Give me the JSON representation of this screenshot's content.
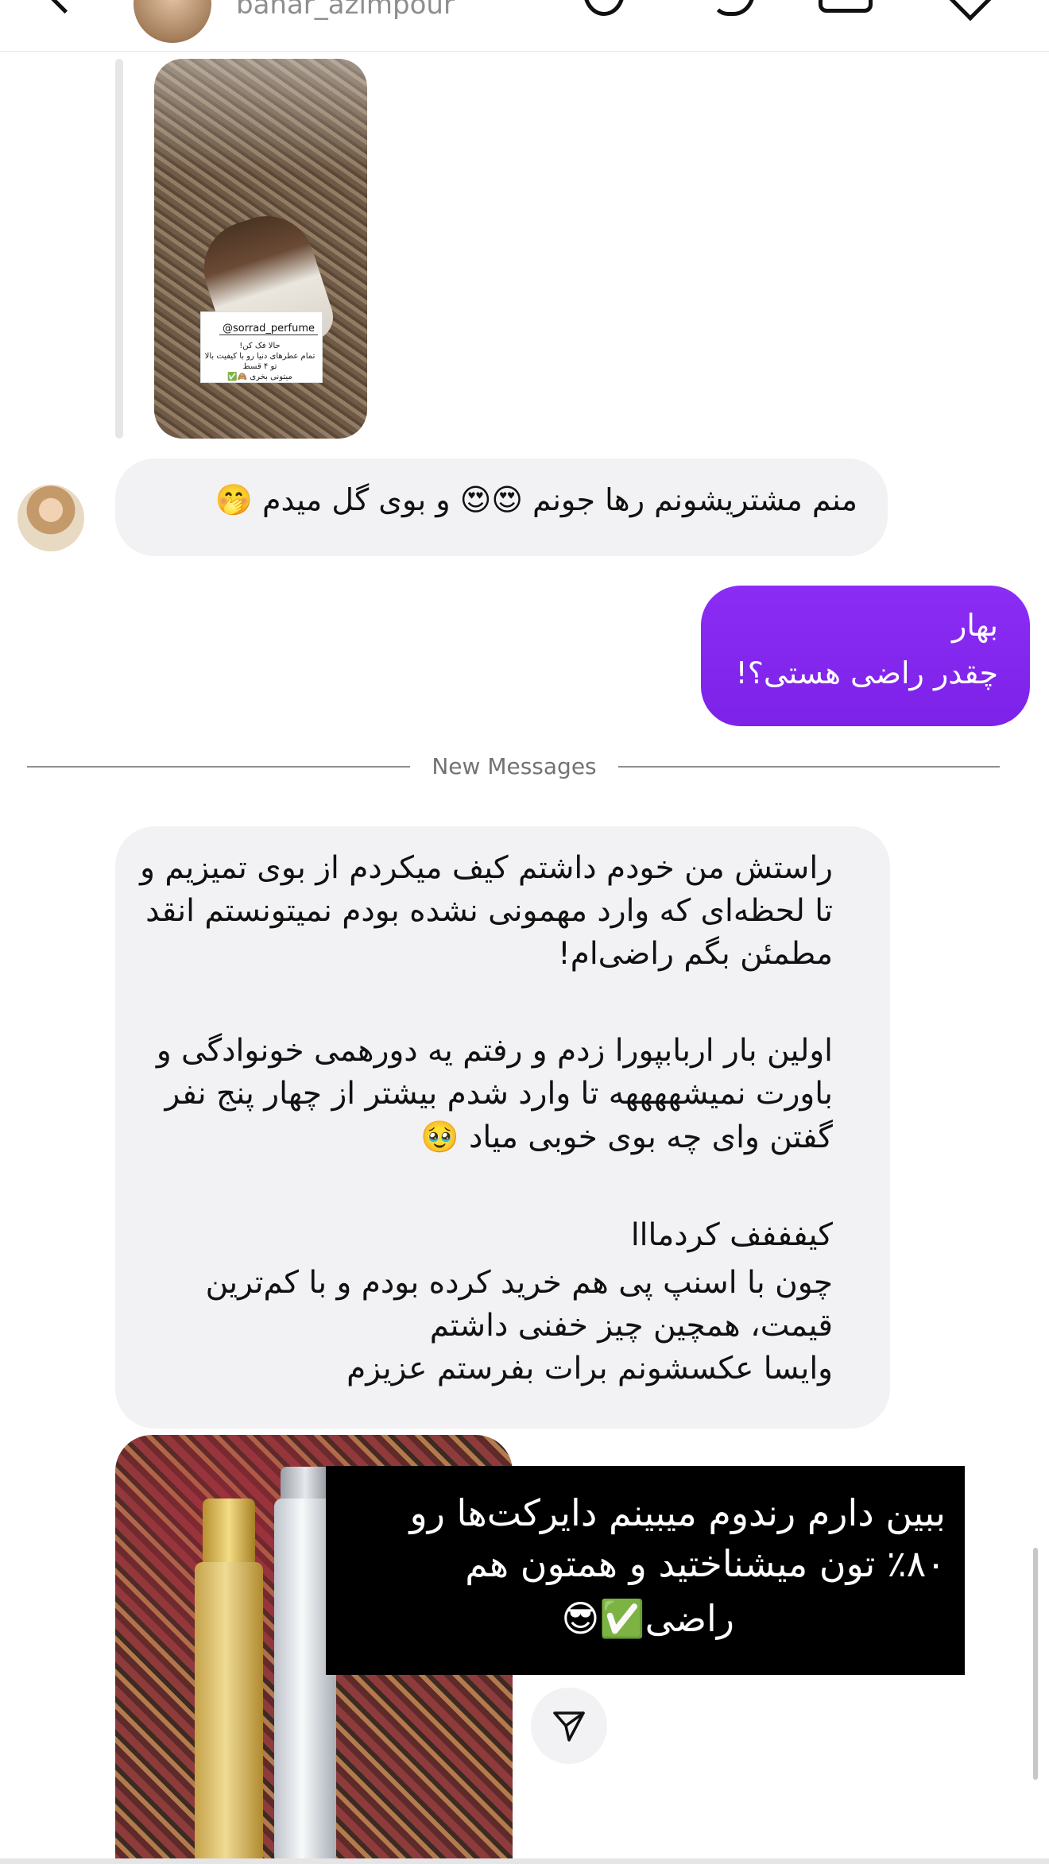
{
  "header": {
    "username": "bahar_azimpour"
  },
  "story": {
    "mention": "@sorrad_perfume",
    "lines": [
      "حالا فک کن!",
      "تمام عطرهای دنیا رو با کیفیت بالا",
      "تو ۴ قسط",
      "میتونی بخری 🙈✅"
    ]
  },
  "messages": {
    "received_1": "منم مشتریشونم رها جونم 😍😍 و بوی گل میدم 🤭",
    "sent_1": {
      "line1": "بهار",
      "line2": "چقدر راضی هستی؟!"
    },
    "divider_label": "New Messages",
    "received_2": {
      "lines": [
        "راستش من خودم داشتم کیف میکردم از بوی تمیزیم و",
        "تا لحظه‌ای که وارد مهمونی نشده بودم نمیتونستم انقد",
        "مطمئن بگم راضی‌ام!",
        "اولین بار اربابپورا زدم و رفتم یه دورهمی خونوادگی و",
        "باورت نمیشههههه تا وارد شدم بیشتر از چهار پنج نفر",
        "گفتن وای چه بوی خوبی میاد 🥹",
        "کیفففف کردمااا",
        "چون با اسنپ پی هم خرید کرده بودم و با کم‌ترین",
        "قیمت، همچین چیز خفنی داشتم",
        "وایسا عکسشونم برات بفرستم عزیزم"
      ]
    },
    "photo_overlay": {
      "line1": "ببین دارم رندوم میبینم دایرکت‌ها رو",
      "line2": "٪۸۰ تون میشناختید و همتون هم",
      "line3": "راضی✅😎"
    }
  },
  "icons": {
    "share": "send-icon"
  },
  "colors": {
    "sent_bubble": "#8b2cf5",
    "received_bubble": "#f2f2f4",
    "divider": "#8e8e8e"
  }
}
